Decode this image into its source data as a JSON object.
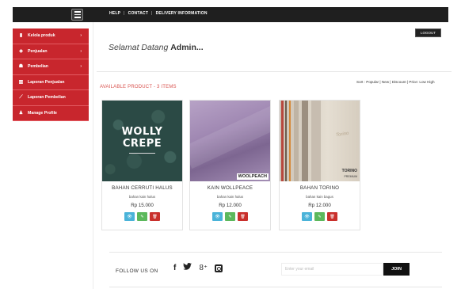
{
  "header": {
    "menu_icon": "hamburger-icon",
    "links": [
      "HELP",
      "CONTACT",
      "DELIVERY INFORMATION"
    ],
    "separator": "|",
    "logout_label": "LOGOUT"
  },
  "sidebar": {
    "items": [
      {
        "label": "Kelola produk",
        "icon": "book-icon",
        "chevron": "›"
      },
      {
        "label": "Penjualan",
        "icon": "tag-icon",
        "chevron": "›"
      },
      {
        "label": "Pembelian",
        "icon": "users-icon",
        "chevron": "›"
      },
      {
        "label": "Laporan Penjualan",
        "icon": "bar-chart-icon"
      },
      {
        "label": "Laporan Pembelian",
        "icon": "line-chart-icon"
      },
      {
        "label": "Manage Profile",
        "icon": "user-icon"
      }
    ]
  },
  "welcome": {
    "greeting": "Selamat Datang",
    "name": "Admin...",
    "name_text": "Admin..."
  },
  "products": {
    "heading": "AVAILABLE PRODUCT - 3 ITEMS",
    "sort_text": "Sort : Popular | New | Discount | Price: Low High",
    "items": [
      {
        "name": "BAHAN CERRUTI HALUS",
        "desc": "bahan kain halus",
        "price": "Rp 15.000",
        "image_text_1": "WOLLY",
        "image_text_2": "CREPE"
      },
      {
        "name": "KAIN WOLLPEACE",
        "desc": "bahan kain halus",
        "price": "Rp 12.000",
        "image_label": "WOOLPEACH"
      },
      {
        "name": "BAHAN TORINO",
        "desc": "bahan kain bagus",
        "price": "Rp 12.000",
        "image_label_1": "TORINO",
        "image_label_2": "PREMIUM",
        "image_mark": "Torino"
      }
    ],
    "buttons": {
      "view": "👁",
      "edit": "✎",
      "delete": "🗑"
    }
  },
  "footer": {
    "follow_label": "FOLLOW US ON",
    "social": {
      "facebook": "f",
      "twitter": "🐦",
      "googleplus": "8⁺"
    },
    "email_placeholder": "Enter your email",
    "join_label": "JOIN"
  },
  "colors": {
    "sidebar": "#c8262d",
    "topbar": "#1f1f1f",
    "accent_heading": "#d9534f",
    "btn_view": "#4ab3d9",
    "btn_edit": "#5cb85c",
    "btn_delete": "#c9302c"
  }
}
